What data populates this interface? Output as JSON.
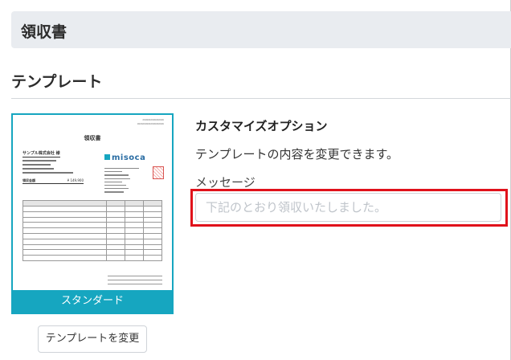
{
  "header": {
    "title": "領収書"
  },
  "section": {
    "title": "テンプレート"
  },
  "template": {
    "preview": {
      "doc_title": "領収書",
      "client": "サンプル株式会社 様",
      "logo_text": "misoca",
      "amount_label": "領収金額",
      "amount_value": "¥ 149,900"
    },
    "name": "スタンダード",
    "change_button": "テンプレートを変更"
  },
  "options": {
    "title": "カスタマイズオプション",
    "description": "テンプレートの内容を変更できます。",
    "message_label": "メッセージ",
    "message_placeholder": "下記のとおり領収いたしました。",
    "message_value": ""
  },
  "colors": {
    "accent": "#16a6c0",
    "highlight": "#e0121b"
  }
}
